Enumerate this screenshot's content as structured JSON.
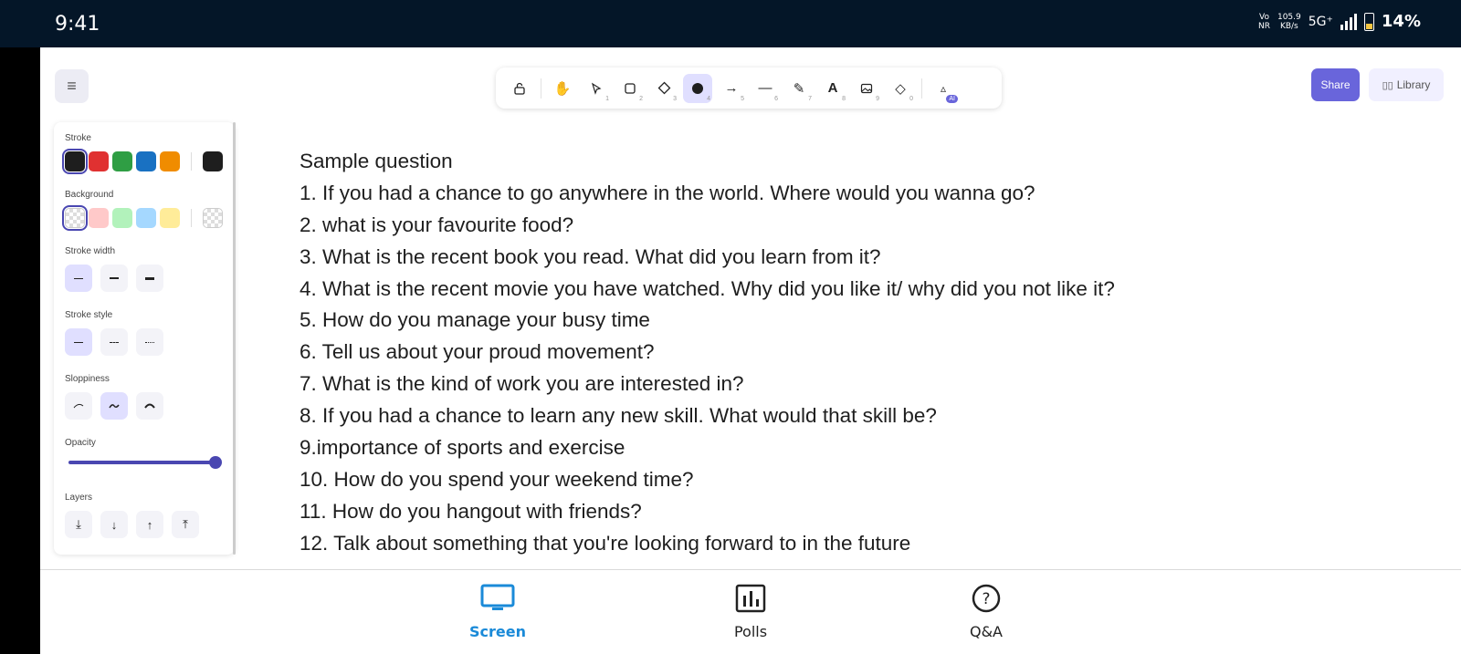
{
  "status_bar": {
    "time": "9:41",
    "volte_top": "Vo",
    "volte_bottom": "NR",
    "speed_value": "105.9",
    "speed_unit": "KB/s",
    "network": "5G⁺",
    "battery": "14%"
  },
  "toolbar": {
    "tools": [
      {
        "name": "lock",
        "key": ""
      },
      {
        "name": "hand",
        "key": ""
      },
      {
        "name": "selection",
        "key": "1"
      },
      {
        "name": "rectangle",
        "key": "2"
      },
      {
        "name": "diamond",
        "key": "3"
      },
      {
        "name": "ellipse",
        "key": "4",
        "active": true
      },
      {
        "name": "arrow",
        "key": "5"
      },
      {
        "name": "line",
        "key": "6"
      },
      {
        "name": "draw",
        "key": "7"
      },
      {
        "name": "text",
        "key": "8"
      },
      {
        "name": "image",
        "key": "9"
      },
      {
        "name": "eraser",
        "key": "0"
      },
      {
        "name": "more-tools",
        "key": ""
      }
    ],
    "ai_badge": "AI"
  },
  "header": {
    "share_label": "Share",
    "library_label": "Library"
  },
  "panel": {
    "stroke_label": "Stroke",
    "stroke_colors": [
      "#1e1e1e",
      "#e03131",
      "#2f9e44",
      "#1971c2",
      "#f08c00"
    ],
    "stroke_current": "#1e1e1e",
    "background_label": "Background",
    "background_colors": [
      "transparent",
      "#ffc9c9",
      "#b2f2bb",
      "#a5d8ff",
      "#ffec99"
    ],
    "stroke_width_label": "Stroke width",
    "stroke_style_label": "Stroke style",
    "sloppiness_label": "Sloppiness",
    "opacity_label": "Opacity",
    "opacity_value": 1.0,
    "layers_label": "Layers"
  },
  "canvas": {
    "lines": [
      "Sample question",
      "1. If you had a chance to go anywhere in the world. Where would you wanna go?",
      "2. what is your favourite food?",
      "3. What is the recent book you read. What did you learn from it?",
      "4. What is the recent movie you have watched. Why did you like it/ why did you not like it?",
      "5. How do you manage your busy time",
      "6. Tell us about your proud movement?",
      "7. What is the kind of work you are interested in?",
      "8. If you had a chance to learn any new skill. What would that skill be?",
      "9.importance of sports and exercise",
      "10. How do you spend your weekend time?",
      "11. How do you hangout with friends?",
      "12. Talk about something that you're looking forward to in the future"
    ]
  },
  "bottom_nav": {
    "items": [
      {
        "label": "Screen",
        "icon": "monitor-icon",
        "active": true
      },
      {
        "label": "Polls",
        "icon": "bar-chart-icon",
        "active": false
      },
      {
        "label": "Q&A",
        "icon": "question-icon",
        "active": false
      }
    ],
    "active_color": "#1a8ad8"
  }
}
